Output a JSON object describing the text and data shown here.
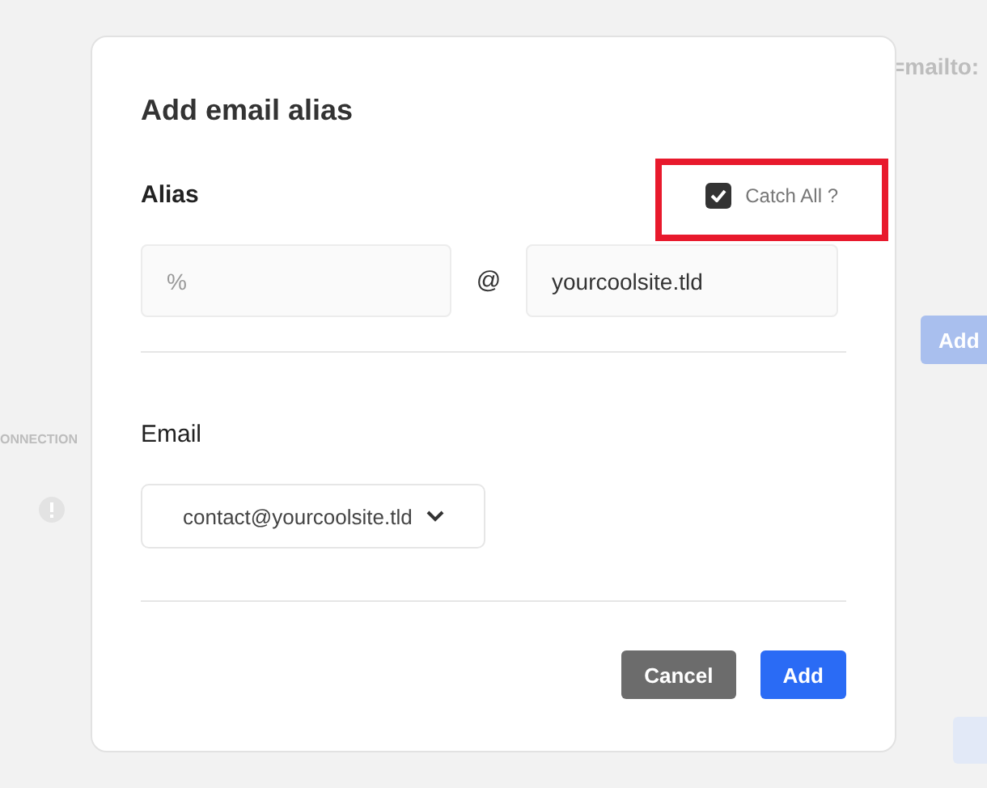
{
  "background": {
    "link_text": "=mailto:",
    "add_button": "Add",
    "section_label": "ONNECTION"
  },
  "dialog": {
    "title": "Add email alias",
    "alias": {
      "label": "Alias",
      "catch_all": {
        "label": "Catch All ?",
        "checked": true
      },
      "local_part": {
        "placeholder": "%"
      },
      "separator": "@",
      "domain": {
        "value": "yourcoolsite.tld"
      }
    },
    "email": {
      "label": "Email",
      "value": "contact@yourcoolsite.tld"
    },
    "buttons": [
      {
        "label": "Cancel",
        "kind": "secondary"
      },
      {
        "label": "Add",
        "kind": "primary"
      }
    ]
  }
}
